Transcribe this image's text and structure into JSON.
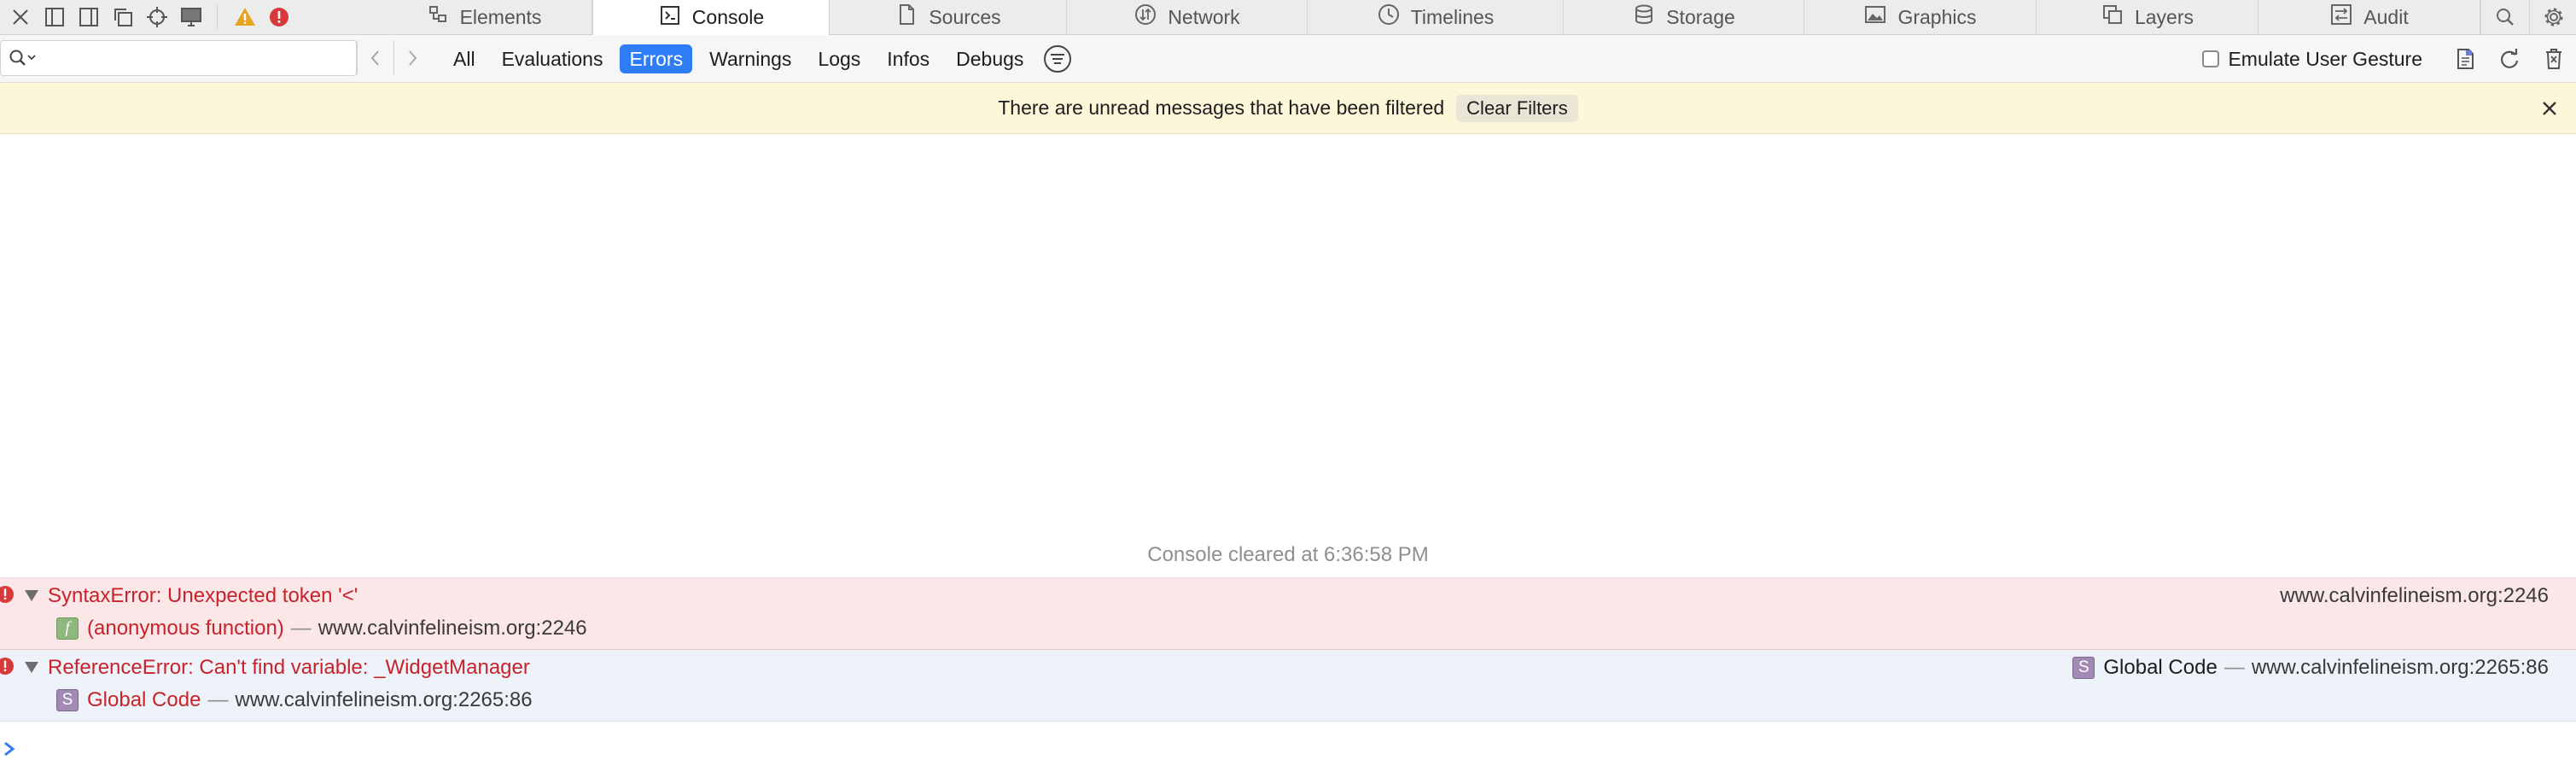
{
  "tabs": [
    {
      "label": "Elements",
      "icon": "elements-icon",
      "active": false
    },
    {
      "label": "Console",
      "icon": "console-icon",
      "active": true
    },
    {
      "label": "Sources",
      "icon": "sources-icon",
      "active": false
    },
    {
      "label": "Network",
      "icon": "network-icon",
      "active": false
    },
    {
      "label": "Timelines",
      "icon": "timelines-icon",
      "active": false
    },
    {
      "label": "Storage",
      "icon": "storage-icon",
      "active": false
    },
    {
      "label": "Graphics",
      "icon": "graphics-icon",
      "active": false
    },
    {
      "label": "Layers",
      "icon": "layers-icon",
      "active": false
    },
    {
      "label": "Audit",
      "icon": "audit-icon",
      "active": false
    }
  ],
  "filters": {
    "buttons": [
      "All",
      "Evaluations",
      "Errors",
      "Warnings",
      "Logs",
      "Infos",
      "Debugs"
    ],
    "active": "Errors",
    "emulate_label": "Emulate User Gesture"
  },
  "banner": {
    "message": "There are unread messages that have been filtered",
    "clear_label": "Clear Filters"
  },
  "console": {
    "cleared_text": "Console cleared at 6:36:58 PM",
    "messages": [
      {
        "text": "SyntaxError: Unexpected token '<'",
        "source": "www.calvinfelineism.org:2246",
        "frame_badge": "f",
        "frame_name": "(anonymous function)",
        "frame_dash": "—",
        "frame_location": "www.calvinfelineism.org:2246"
      },
      {
        "text": "ReferenceError: Can't find variable: _WidgetManager",
        "source_badge": "S",
        "source_name": "Global Code",
        "source_dash": "—",
        "source": "www.calvinfelineism.org:2265:86",
        "frame_badge": "S",
        "frame_name": "Global Code",
        "frame_dash": "—",
        "frame_location": "www.calvinfelineism.org:2265:86"
      }
    ]
  },
  "colors": {
    "active_filter": "#2f7df6",
    "error_text": "#c8222a",
    "banner_bg": "#fdf6d9",
    "error_row_bg": "#fbe7e8",
    "selected_row_bg": "#eef3f9"
  }
}
